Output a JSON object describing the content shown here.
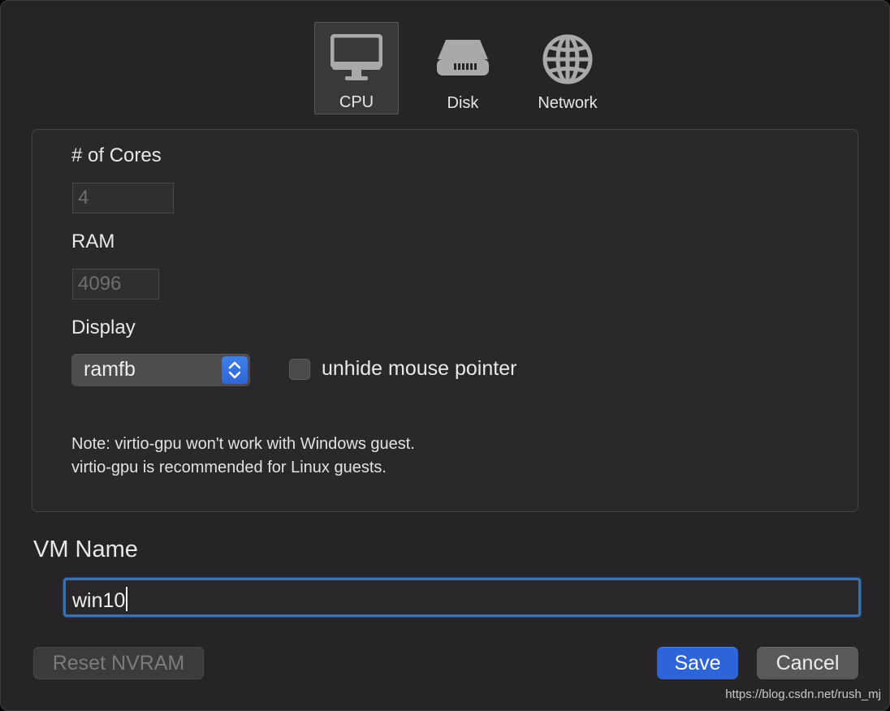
{
  "tabs": [
    {
      "label": "CPU",
      "icon": "monitor-icon",
      "selected": true
    },
    {
      "label": "Disk",
      "icon": "disk-drive-icon",
      "selected": false
    },
    {
      "label": "Network",
      "icon": "globe-icon",
      "selected": false
    }
  ],
  "cpu": {
    "cores_label": "# of Cores",
    "cores_value": "4",
    "ram_label": "RAM",
    "ram_value": "4096",
    "display_label": "Display",
    "display_selected": "ramfb",
    "unhide_label": "unhide mouse pointer",
    "unhide_checked": false,
    "note_line1": "Note: virtio-gpu won't work with Windows guest.",
    "note_line2": "virtio-gpu is recommended for Linux guests."
  },
  "vm": {
    "name_label": "VM Name",
    "name_value": "win10"
  },
  "buttons": {
    "reset": "Reset NVRAM",
    "save": "Save",
    "cancel": "Cancel"
  },
  "watermark": "https://blog.csdn.net/rush_mj",
  "colors": {
    "window_bg": "#262427",
    "accent_blue": "#2d64d8",
    "focus_ring": "#3b6fa9"
  }
}
